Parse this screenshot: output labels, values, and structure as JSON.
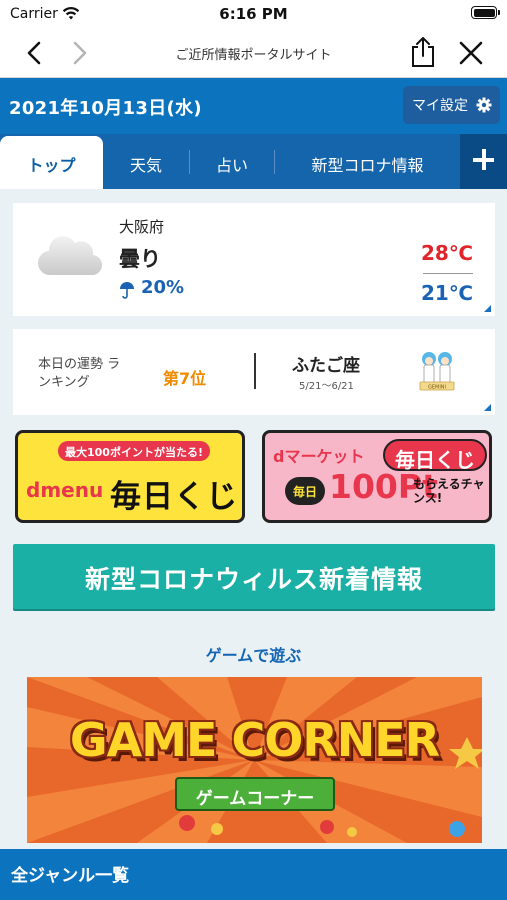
{
  "status_bar": {
    "carrier": "Carrier",
    "time": "6:16 PM"
  },
  "nav": {
    "title": "ご近所情報ポータルサイト"
  },
  "header": {
    "date": "2021年10月13日(水)",
    "settings_label": "マイ設定"
  },
  "tabs": [
    {
      "label": "トップ",
      "active": true
    },
    {
      "label": "天気",
      "active": false
    },
    {
      "label": "占い",
      "active": false
    },
    {
      "label": "新型コロナ情報",
      "active": false
    }
  ],
  "weather": {
    "city": "大阪府",
    "condition": "曇り",
    "rain_chance": "20%",
    "high": "28℃",
    "low": "21℃",
    "icon": "cloud-icon"
  },
  "fortune": {
    "label": "本日の運勢 ランキング",
    "rank": "第7位",
    "sign": "ふたご座",
    "dates": "5/21〜6/21",
    "badge_text": "GEMINI"
  },
  "banners": {
    "dmenu": {
      "top_text": "最大100ポイントが当たる!",
      "logo": "dmenu",
      "main": "毎日くじ"
    },
    "dmarket": {
      "logo": "dマーケット",
      "title": "毎日くじ",
      "daily": "毎日",
      "points": "100Pt",
      "chance": "もらえるチャンス!"
    }
  },
  "corona_banner": "新型コロナウィルス新着情報",
  "game_section": {
    "title": "ゲームで遊ぶ",
    "banner_title": "GAME CORNER",
    "banner_sub": "ゲームコーナー"
  },
  "genre_bar": "全ジャンル一覧",
  "colors": {
    "primary": "#0c73bf",
    "tab_dark": "#1565ac",
    "teal": "#1bb0a6",
    "hot": "#e0242a",
    "cold": "#1a62b3",
    "rank": "#f08a00"
  }
}
